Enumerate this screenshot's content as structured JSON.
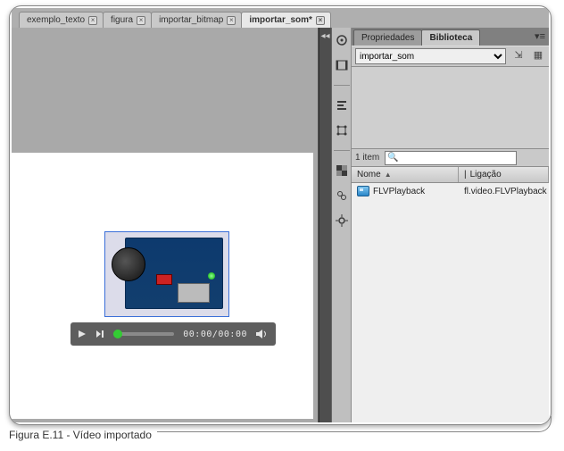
{
  "tabs": [
    {
      "label": "exemplo_texto",
      "active": false
    },
    {
      "label": "figura",
      "active": false
    },
    {
      "label": "importar_bitmap",
      "active": false
    },
    {
      "label": "importar_som*",
      "active": true
    }
  ],
  "playbar": {
    "time": "00:00/00:00"
  },
  "panel": {
    "tabs": {
      "props": "Propriedades",
      "library": "Biblioteca"
    },
    "libselect_value": "importar_som",
    "item_count": "1 item",
    "columns": {
      "name": "Nome",
      "link": "Ligação"
    },
    "rows": [
      {
        "name": "FLVPlayback",
        "link": "fl.video.FLVPlayback"
      }
    ]
  },
  "caption": "Figura E.11 - Vídeo importado"
}
